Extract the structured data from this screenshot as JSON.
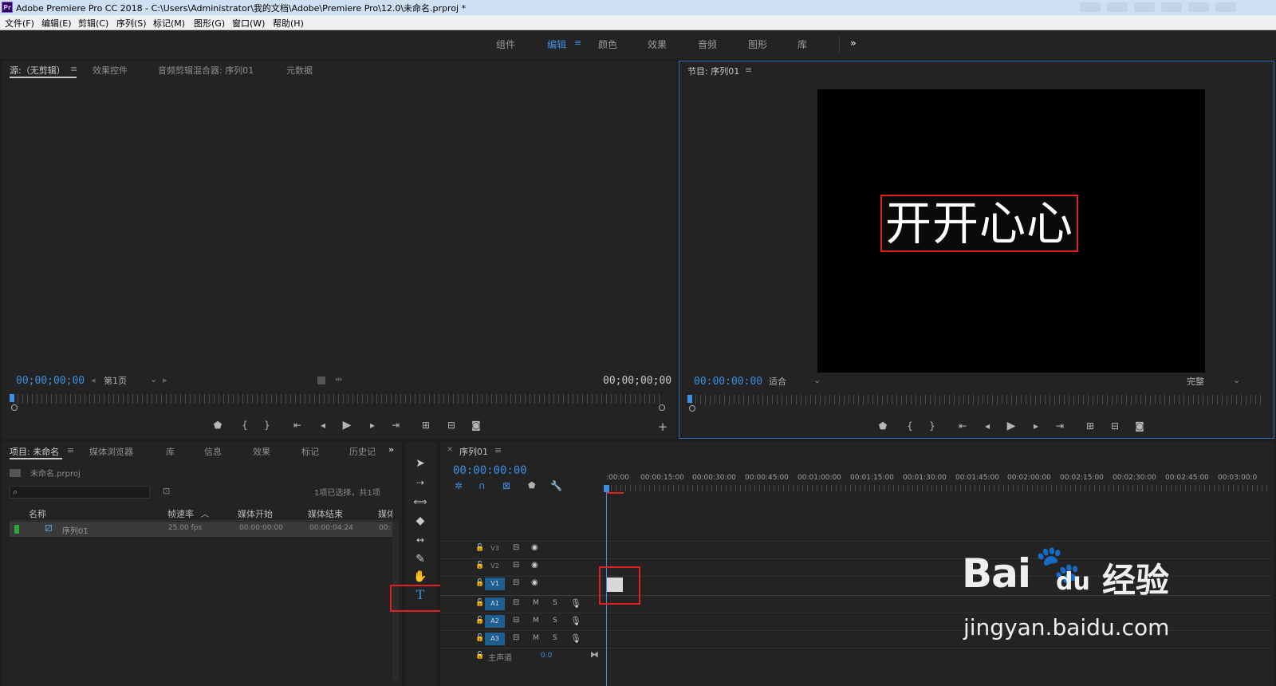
{
  "window": {
    "app_icon": "Pr",
    "title": "Adobe Premiere Pro CC 2018 - C:\\Users\\Administrator\\我的文档\\Adobe\\Premiere Pro\\12.0\\未命名.prproj *"
  },
  "menu": [
    "文件(F)",
    "编辑(E)",
    "剪辑(C)",
    "序列(S)",
    "标记(M)",
    "图形(G)",
    "窗口(W)",
    "帮助(H)"
  ],
  "workspaces": {
    "items": [
      "组件",
      "编辑",
      "颜色",
      "效果",
      "音频",
      "图形",
      "库"
    ],
    "active": "编辑",
    "more": "»"
  },
  "source_panel": {
    "tabs": [
      "源:（无剪辑）",
      "效果控件",
      "音频剪辑混合器: 序列01",
      "元数据"
    ],
    "timecode_left": "00;00;00;00",
    "page_select": "第1页",
    "timecode_right": "00;00;00;00"
  },
  "program_panel": {
    "tab": "节目: 序列01",
    "preview_text": "开开心心",
    "timecode": "00:00:00:00",
    "fit_select": "适合",
    "quality_select": "完整"
  },
  "project_panel": {
    "tabs": [
      "项目: 未命名",
      "媒体浏览器",
      "库",
      "信息",
      "效果",
      "标记",
      "历史记"
    ],
    "file_name": "未命名.prproj",
    "selection_info": "1项已选择，共1项",
    "columns": [
      "名称",
      "帧速率",
      "媒体开始",
      "媒体结束",
      "媒体"
    ],
    "rows": [
      {
        "name": "序列01",
        "fps": "25.00 fps",
        "start": "00:00:00:00",
        "end": "00:00:04:24",
        "extra": "00:"
      }
    ]
  },
  "timeline": {
    "tab": "序列01",
    "timecode": "00:00:00:00",
    "ruler": [
      ":00:00",
      "00:00:15:00",
      "00:00:30:00",
      "00:00:45:00",
      "00:01:00:00",
      "00:01:15:00",
      "00:01:30:00",
      "00:01:45:00",
      "00:02:00:00",
      "00:02:15:00",
      "00:02:30:00",
      "00:02:45:00",
      "00:03:00:0"
    ],
    "video_tracks": [
      "V3",
      "V2",
      "V1"
    ],
    "audio_tracks": [
      "A1",
      "A2",
      "A3"
    ],
    "audio_mute": "M",
    "audio_solo": "S",
    "master_label": "主声道",
    "master_value": "0.0"
  },
  "watermark": {
    "brand": "Bai",
    "brand_tail": "du",
    "cn": "经验",
    "url": "jingyan.baidu.com"
  },
  "colors": {
    "accent": "#3d8fe0",
    "highlight": "#e02020",
    "bg": "#1d1d1d"
  }
}
